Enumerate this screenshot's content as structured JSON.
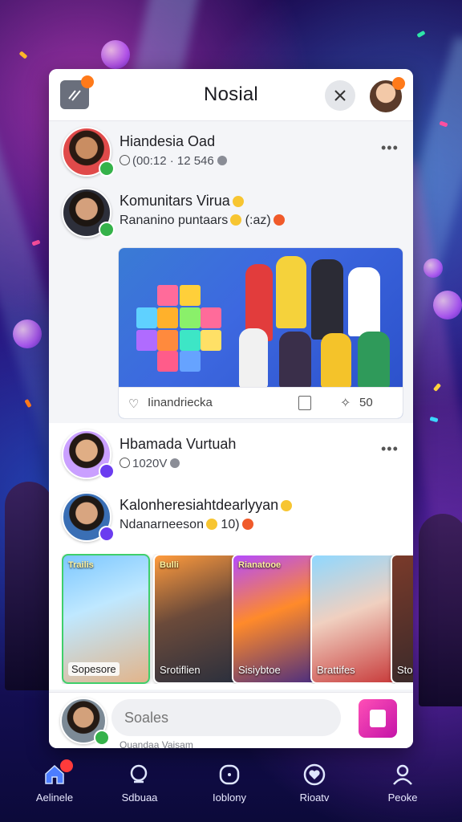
{
  "app": {
    "title": "Nosial",
    "menu_badge": "",
    "colors": {
      "accent": "#ff7a1a",
      "compose": "#e02db2",
      "online": "#35b24a",
      "verified": "#6b3cf0"
    }
  },
  "posts": [
    {
      "author": "Hiandesia Oad",
      "meta": "(00:12 · 12 546",
      "icons": [
        "clock-icon",
        "globe-icon"
      ],
      "status": "online"
    },
    {
      "author": "Komunitars Virua",
      "text": "Rananino puntaars",
      "suffix": "(:az)",
      "status": "online"
    }
  ],
  "image_post": {
    "caption": "Iinandriecka",
    "count": "50"
  },
  "section2": [
    {
      "author": "Hbamada Vurtuah",
      "meta": "1020V",
      "status": "verified"
    },
    {
      "author": "Kalonheresiahtdearlyyan",
      "text": "Ndanarneeson",
      "suffix": "10)",
      "status": "verified"
    }
  ],
  "stories": [
    {
      "tag": "Trailis",
      "label": "Sopesore"
    },
    {
      "tag": "Bulli",
      "label": "Srotiflien"
    },
    {
      "tag": "Rianatooe",
      "label": "Sisiybtoe"
    },
    {
      "tag": "",
      "label": "Brattifes"
    },
    {
      "tag": "",
      "label": "Stor"
    }
  ],
  "composer": {
    "placeholder": "Soales",
    "subtext": "Quandaa Vaisam"
  },
  "nav": [
    {
      "label": "Aelinele",
      "icon": "home-icon",
      "badge": ""
    },
    {
      "label": "Sdbuaa",
      "icon": "search-icon",
      "badge": ""
    },
    {
      "label": "Ioblony",
      "icon": "library-icon",
      "badge": ""
    },
    {
      "label": "Rioatv",
      "icon": "heart-icon",
      "badge": ""
    },
    {
      "label": "Peoke",
      "icon": "profile-icon",
      "badge": ""
    }
  ]
}
